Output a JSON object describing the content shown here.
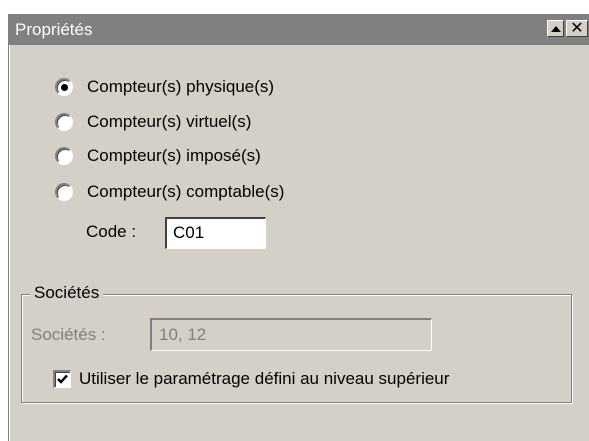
{
  "window": {
    "title": "Propriétés",
    "buttons": {
      "collapse": "▲",
      "close": "✕"
    }
  },
  "counter_type": {
    "options": [
      {
        "label": "Compteur(s) physique(s)",
        "selected": true
      },
      {
        "label": "Compteur(s) virtuel(s)",
        "selected": false
      },
      {
        "label": "Compteur(s) imposé(s)",
        "selected": false
      },
      {
        "label": "Compteur(s) comptable(s)",
        "selected": false
      }
    ]
  },
  "code": {
    "label": "Code :",
    "value": "C01"
  },
  "societes_group": {
    "legend": "Sociétés",
    "field_label": "Sociétés :",
    "field_value": "10, 12",
    "field_disabled": true,
    "checkbox": {
      "label": "Utiliser le paramétrage défini au niveau supérieur",
      "checked": true
    }
  }
}
